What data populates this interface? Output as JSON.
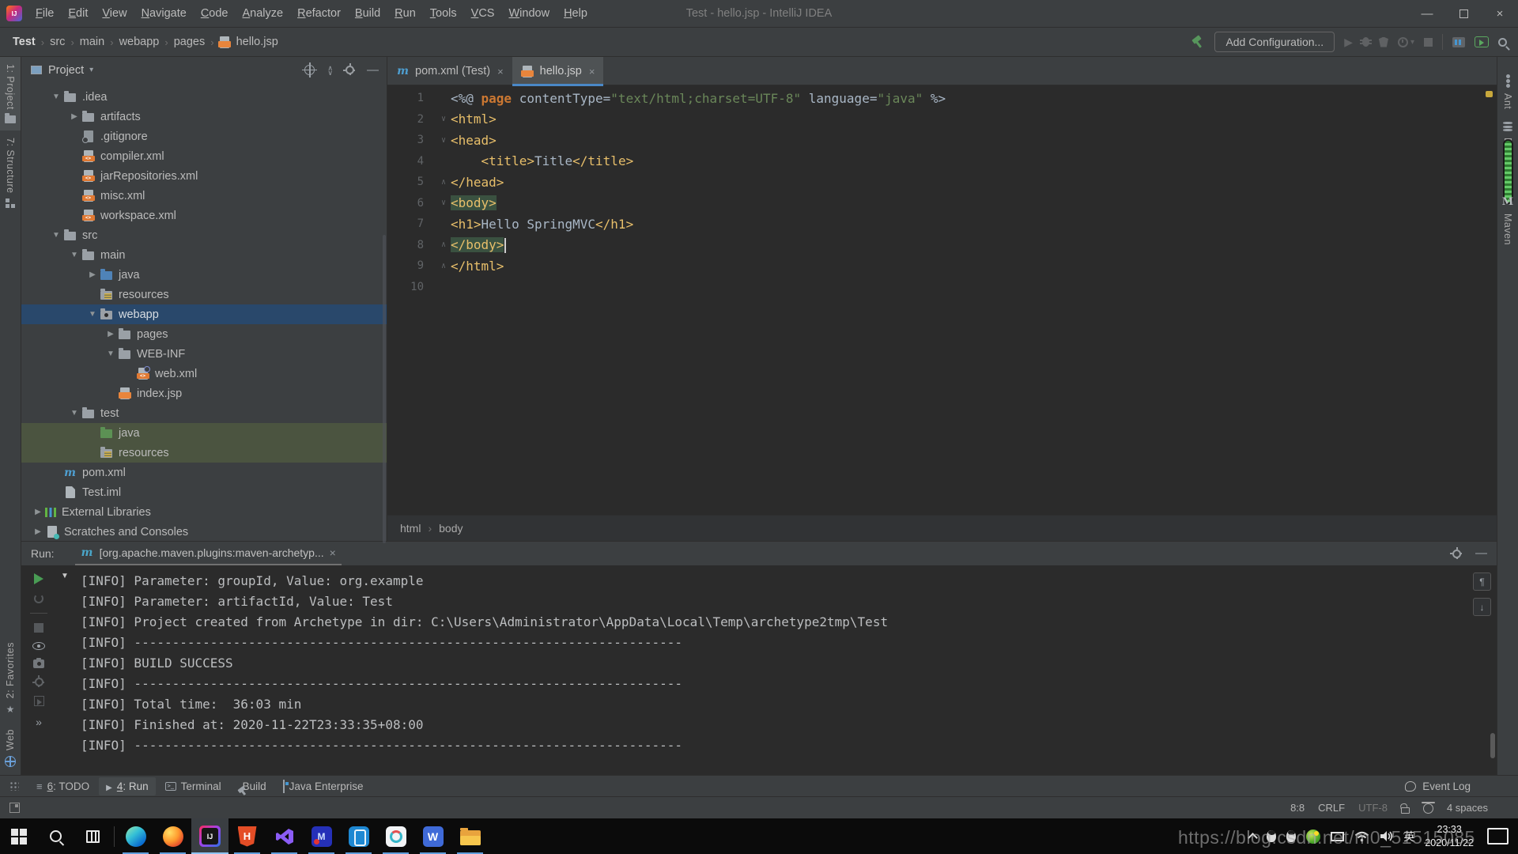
{
  "window": {
    "title": "Test - hello.jsp - IntelliJ IDEA"
  },
  "menubar": [
    "File",
    "Edit",
    "View",
    "Navigate",
    "Code",
    "Analyze",
    "Refactor",
    "Build",
    "Run",
    "Tools",
    "VCS",
    "Window",
    "Help"
  ],
  "navbar": {
    "breadcrumbs": [
      "Test",
      "src",
      "main",
      "webapp",
      "pages"
    ],
    "file": {
      "name": "hello.jsp",
      "icon": "jsp-file-icon"
    },
    "add_configuration": "Add Configuration..."
  },
  "left_stripe": {
    "top": [
      {
        "label": "1: Project",
        "icon": "project-folder-icon",
        "active": true
      },
      {
        "label": "7: Structure",
        "icon": "structure-icon",
        "active": false
      }
    ],
    "bottom": [
      {
        "label": "2: Favorites",
        "icon": "favorites-icon"
      },
      {
        "label": "Web",
        "icon": "web-globe-icon"
      }
    ]
  },
  "right_stripe": [
    {
      "label": "Ant",
      "icon": "ant-icon"
    },
    {
      "label": "Database",
      "icon": "database-icon",
      "badge": "green-progress"
    },
    {
      "label": "Maven",
      "icon": "maven-logo-icon"
    }
  ],
  "project_panel": {
    "title": "Project",
    "tree": [
      {
        "label": ".idea",
        "depth": 1,
        "icon": "folder",
        "arrow": "down"
      },
      {
        "label": "artifacts",
        "depth": 2,
        "icon": "folder",
        "arrow": "right"
      },
      {
        "label": ".gitignore",
        "depth": 2,
        "icon": "ignored-file"
      },
      {
        "label": "compiler.xml",
        "depth": 2,
        "icon": "xml-file"
      },
      {
        "label": "jarRepositories.xml",
        "depth": 2,
        "icon": "xml-file"
      },
      {
        "label": "misc.xml",
        "depth": 2,
        "icon": "xml-file"
      },
      {
        "label": "workspace.xml",
        "depth": 2,
        "icon": "xml-file"
      },
      {
        "label": "src",
        "depth": 1,
        "icon": "folder",
        "arrow": "down"
      },
      {
        "label": "main",
        "depth": 2,
        "icon": "folder",
        "arrow": "down"
      },
      {
        "label": "java",
        "depth": 3,
        "icon": "folder-src",
        "arrow": "right"
      },
      {
        "label": "resources",
        "depth": 3,
        "icon": "folder-res"
      },
      {
        "label": "webapp",
        "depth": 3,
        "icon": "folder-web",
        "arrow": "down",
        "state": "selected"
      },
      {
        "label": "pages",
        "depth": 4,
        "icon": "folder",
        "arrow": "right"
      },
      {
        "label": "WEB-INF",
        "depth": 4,
        "icon": "folder",
        "arrow": "down"
      },
      {
        "label": "web.xml",
        "depth": 5,
        "icon": "xml-gear-file"
      },
      {
        "label": "index.jsp",
        "depth": 4,
        "icon": "jsp-file"
      },
      {
        "label": "test",
        "depth": 2,
        "icon": "folder",
        "arrow": "down"
      },
      {
        "label": "java",
        "depth": 3,
        "icon": "folder-test",
        "state": "green"
      },
      {
        "label": "resources",
        "depth": 3,
        "icon": "folder-testres",
        "state": "green"
      },
      {
        "label": "pom.xml",
        "depth": 1,
        "icon": "maven-m"
      },
      {
        "label": "Test.iml",
        "depth": 1,
        "icon": "plain-file"
      },
      {
        "label": "External Libraries",
        "depth": 0,
        "icon": "library",
        "arrow": "right"
      },
      {
        "label": "Scratches and Consoles",
        "depth": 0,
        "icon": "scratch",
        "arrow": "right"
      }
    ]
  },
  "editor": {
    "tabs": [
      {
        "label": "pom.xml (Test)",
        "icon": "maven-m",
        "active": false
      },
      {
        "label": "hello.jsp",
        "icon": "jsp-file",
        "active": true
      }
    ],
    "breadcrumb": [
      "html",
      "body"
    ],
    "lines": [
      {
        "num": "1",
        "tokens": [
          [
            "<%@ ",
            "text"
          ],
          [
            "page",
            "kw"
          ],
          [
            " contentType=",
            "text"
          ],
          [
            "\"text/html;charset=UTF-8\"",
            "str"
          ],
          [
            " language=",
            "text"
          ],
          [
            "\"java\"",
            "str"
          ],
          [
            " %>",
            "text"
          ]
        ]
      },
      {
        "num": "2",
        "fold": "down",
        "tokens": [
          [
            "<html>",
            "tag"
          ]
        ]
      },
      {
        "num": "3",
        "fold": "down",
        "tokens": [
          [
            "<head>",
            "tag"
          ]
        ]
      },
      {
        "num": "4",
        "tokens": [
          [
            "    ",
            "text"
          ],
          [
            "<title>",
            "tag"
          ],
          [
            "Title",
            "text"
          ],
          [
            "</title>",
            "tag"
          ]
        ]
      },
      {
        "num": "5",
        "fold": "up",
        "tokens": [
          [
            "</head>",
            "tag"
          ]
        ]
      },
      {
        "num": "6",
        "fold": "down",
        "tokens": [
          [
            "<body>",
            "taghl"
          ]
        ]
      },
      {
        "num": "7",
        "tokens": [
          [
            "<h1>",
            "tag"
          ],
          [
            "Hello SpringMVC",
            "text"
          ],
          [
            "</h1>",
            "tag"
          ]
        ]
      },
      {
        "num": "8",
        "fold": "up",
        "caret": true,
        "tokens": [
          [
            "</body>",
            "taghl"
          ]
        ]
      },
      {
        "num": "9",
        "fold": "up",
        "tokens": [
          [
            "</html>",
            "tag"
          ]
        ]
      },
      {
        "num": "10",
        "tokens": []
      }
    ]
  },
  "run_panel": {
    "label": "Run:",
    "tab": {
      "label": "[org.apache.maven.plugins:maven-archetyp...",
      "icon": "maven-m"
    },
    "console": [
      "[INFO] Parameter: groupId, Value: org.example",
      "[INFO] Parameter: artifactId, Value: Test",
      "[INFO] Project created from Archetype in dir: C:\\Users\\Administrator\\AppData\\Local\\Temp\\archetype2tmp\\Test",
      "[INFO] ------------------------------------------------------------------------",
      "[INFO] BUILD SUCCESS",
      "[INFO] ------------------------------------------------------------------------",
      "[INFO] Total time:  36:03 min",
      "[INFO] Finished at: 2020-11-22T23:33:35+08:00",
      "[INFO] ------------------------------------------------------------------------"
    ]
  },
  "tool_window_bar": {
    "items": [
      {
        "num": "6",
        "name": "TODO",
        "icon": "todo-icon",
        "active": false
      },
      {
        "num": "4",
        "name": "Run",
        "icon": "run-icon",
        "active": true
      },
      {
        "num": "",
        "name": "Terminal",
        "icon": "terminal-icon",
        "active": false
      },
      {
        "num": "",
        "name": "Build",
        "icon": "build-hammer-icon",
        "active": false
      },
      {
        "num": "",
        "name": "Java Enterprise",
        "icon": "java-enterprise-icon",
        "active": false
      }
    ],
    "event_log": "Event Log"
  },
  "status_bar": {
    "position": "8:8",
    "line_ending": "CRLF",
    "encoding": "UTF-8",
    "indent": "4 spaces"
  },
  "taskbar": {
    "apps": [
      "edge",
      "firefox",
      "idea",
      "hbuilder",
      "visual-studio",
      "emulator",
      "phone-emulator",
      "itools",
      "wps",
      "file-explorer"
    ],
    "active_app": "idea",
    "ime": "英",
    "time": "23:33",
    "date": "2020/11/22"
  },
  "watermark": "https://blog.csdn.net/m0_51515085",
  "colors": {
    "accent_blue": "#4a88c7",
    "run_green": "#499c54",
    "tag_yellow": "#e8bf6a",
    "string_green": "#6a8759",
    "keyword_orange": "#cc7832",
    "selection_blue": "#29486b",
    "test_row_green": "#4b5440"
  }
}
